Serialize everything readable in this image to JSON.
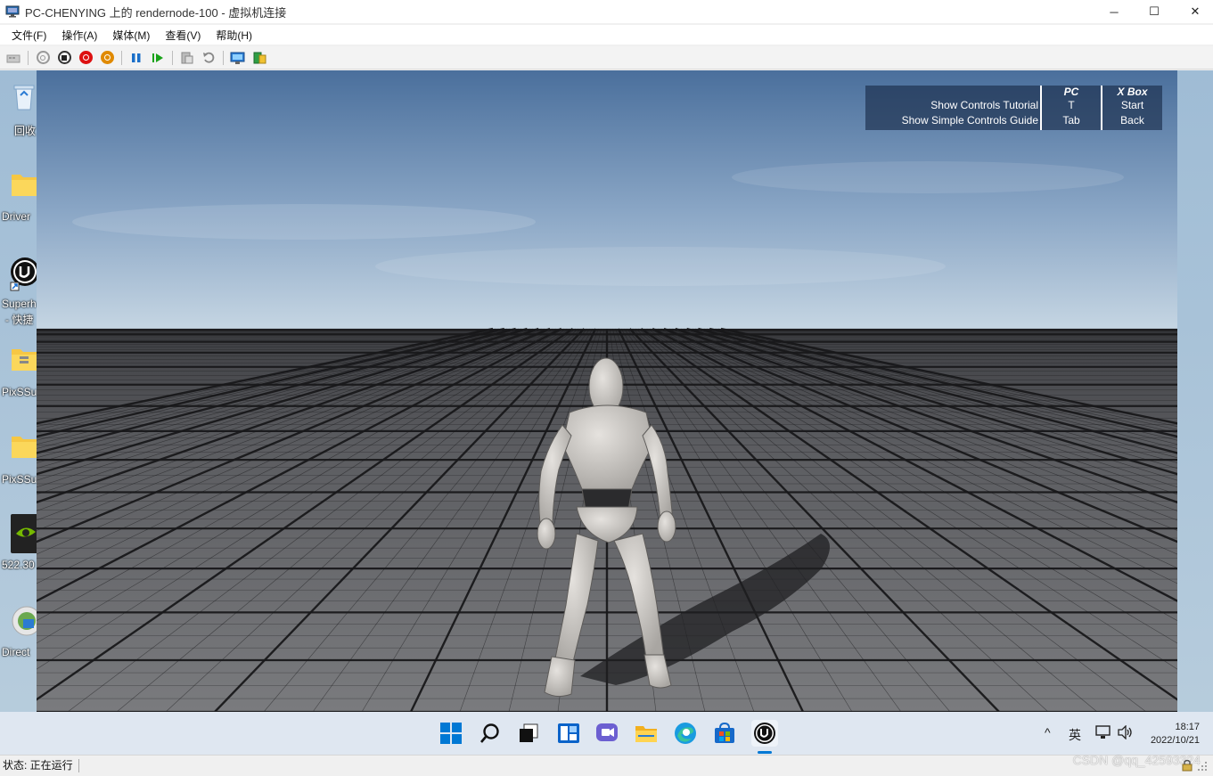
{
  "window": {
    "title": "PC-CHENYING 上的 rendernode-100 - 虚拟机连接",
    "minimize_glyph": "─",
    "maximize_glyph": "☐",
    "close_glyph": "✕"
  },
  "menu": [
    "文件(F)",
    "操作(A)",
    "媒体(M)",
    "查看(V)",
    "帮助(H)"
  ],
  "toolbar_icons": [
    "ctrl-alt-del-icon",
    "start-icon",
    "turn-off-icon",
    "shutdown-icon",
    "save-icon",
    "pause-icon",
    "resume-icon",
    "checkpoint-icon",
    "revert-icon",
    "enhanced-session-icon",
    "share-icon"
  ],
  "desktop_icons": [
    {
      "label": "回收",
      "icon": "recycle-bin-icon"
    },
    {
      "label": "Driver",
      "icon": "folder-icon"
    },
    {
      "label": "Superh",
      "label2": "- 快捷",
      "icon": "unreal-engine-icon"
    },
    {
      "label": "PixSSu",
      "icon": "zip-folder-icon"
    },
    {
      "label": "PixSSu",
      "icon": "folder-icon"
    },
    {
      "label": "522.30",
      "icon": "nvidia-icon"
    },
    {
      "label": "Direct",
      "icon": "directx-icon"
    }
  ],
  "controls_guide": {
    "actions": [
      "Show Controls Tutorial",
      "Show Simple Controls Guide"
    ],
    "pc_header": "PC",
    "pc_keys": [
      "T",
      "Tab"
    ],
    "xbox_header": "X Box",
    "xbox_keys": [
      "Start",
      "Back"
    ]
  },
  "taskbar": {
    "apps": [
      "start-icon",
      "search-icon",
      "task-view-icon",
      "widgets-icon",
      "teams-chat-icon",
      "file-explorer-icon",
      "edge-icon",
      "store-icon",
      "unreal-engine-icon"
    ],
    "tray_chevron": "^",
    "ime": "英",
    "time": "18:17",
    "date": "2022/10/21"
  },
  "status": {
    "text": "状态: 正在运行",
    "watermark": "CSDN @qq_42593324"
  },
  "colors": {
    "accent_blue": "#0078d4",
    "stop_red": "#d11",
    "shutdown_orange": "#e08a00",
    "play_green": "#1aa31a"
  }
}
